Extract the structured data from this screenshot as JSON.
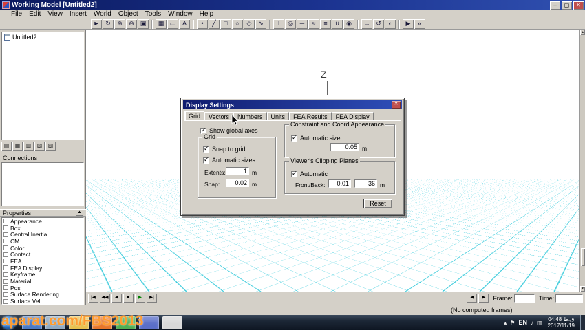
{
  "titlebar": {
    "title": "Working Model [Untitled2]",
    "buttons": [
      {
        "name": "minimize-button",
        "glyph": "–"
      },
      {
        "name": "maximize-button",
        "glyph": "▢"
      },
      {
        "name": "close-button",
        "glyph": "✕",
        "bg": "#c0504d",
        "color": "#ffffff"
      }
    ]
  },
  "menubar": {
    "items": [
      "File",
      "Edit",
      "View",
      "Insert",
      "World",
      "Object",
      "Tools",
      "Window",
      "Help"
    ]
  },
  "toolbar": {
    "icons": [
      {
        "name": "select-tool-icon",
        "glyph": "►"
      },
      {
        "name": "rotate-tool-icon",
        "glyph": "↻"
      },
      {
        "name": "zoom-in-icon",
        "glyph": "⊕"
      },
      {
        "name": "zoom-out-icon",
        "glyph": "⊖"
      },
      {
        "name": "zoom-extents-icon",
        "glyph": "▣"
      },
      {
        "sep": true
      },
      {
        "name": "grid-snap-icon",
        "glyph": "▦"
      },
      {
        "name": "ruler-icon",
        "glyph": "▭"
      },
      {
        "name": "text-tool-icon",
        "glyph": "A"
      },
      {
        "sep": true
      },
      {
        "name": "point-tool-icon",
        "glyph": "•"
      },
      {
        "name": "line-tool-icon",
        "glyph": "╱"
      },
      {
        "name": "rectangle-tool-icon",
        "glyph": "□"
      },
      {
        "name": "circle-tool-icon",
        "glyph": "○"
      },
      {
        "name": "polygon-tool-icon",
        "glyph": "◇"
      },
      {
        "name": "curve-tool-icon",
        "glyph": "∿"
      },
      {
        "sep": true
      },
      {
        "name": "anchor-tool-icon",
        "glyph": "⊥"
      },
      {
        "name": "pin-joint-icon",
        "glyph": "◎"
      },
      {
        "name": "rod-tool-icon",
        "glyph": "─"
      },
      {
        "name": "spring-tool-icon",
        "glyph": "≈"
      },
      {
        "name": "damper-tool-icon",
        "glyph": "≡"
      },
      {
        "name": "rope-tool-icon",
        "glyph": "∪"
      },
      {
        "name": "pulley-tool-icon",
        "glyph": "◉"
      },
      {
        "sep": true
      },
      {
        "name": "force-tool-icon",
        "glyph": "→"
      },
      {
        "name": "torque-tool-icon",
        "glyph": "↺"
      },
      {
        "name": "motor-tool-icon",
        "glyph": "◐"
      },
      {
        "sep": true
      },
      {
        "name": "run-tool-icon",
        "glyph": "▶"
      },
      {
        "name": "reset-tool-icon",
        "glyph": "«"
      }
    ]
  },
  "sidebar": {
    "tree_root": "Untitled2",
    "mini_tabs": [
      {
        "name": "browser-outline-tab",
        "glyph": "▤"
      },
      {
        "name": "browser-grid-tab",
        "glyph": "▦"
      },
      {
        "name": "browser-split-tab",
        "glyph": "▥"
      },
      {
        "name": "browser-diagonal-tab",
        "glyph": "▧"
      },
      {
        "name": "browser-shade-tab",
        "glyph": "▨"
      }
    ],
    "connections_label": "Connections",
    "properties_label": "Properties",
    "collapse_glyph": "▲",
    "properties": [
      "Appearance",
      "Box",
      "Central Inertia",
      "CM",
      "Color",
      "Contact",
      "FEA",
      "FEA Display",
      "Keyframe",
      "Material",
      "Pos",
      "Surface Rendering",
      "Surface Vel"
    ]
  },
  "canvas": {
    "axis_label": "Z",
    "grid_color": "#2cc7d9",
    "scroll_up_glyph": "▲",
    "scroll_down_glyph": "▼"
  },
  "dialog": {
    "title": "Display Settings",
    "close_glyph": "✕",
    "tabs": [
      {
        "name": "tab-grid",
        "label": "Grid",
        "selected": true
      },
      {
        "name": "tab-vectors",
        "label": "Vectors"
      },
      {
        "name": "tab-numbers",
        "label": "Numbers"
      },
      {
        "name": "tab-units",
        "label": "Units"
      },
      {
        "name": "tab-fea-results",
        "label": "FEA Results"
      },
      {
        "name": "tab-fea-display",
        "label": "FEA Display"
      }
    ],
    "show_global_axes": {
      "label": "Show global axes",
      "checked": true
    },
    "grid_group": {
      "title": "Grid",
      "snap_to_grid": {
        "label": "Snap to grid",
        "checked": true
      },
      "automatic_sizes": {
        "label": "Automatic sizes",
        "checked": true
      },
      "extents_label": "Extents:",
      "extents_value": "1",
      "extents_unit": "m",
      "snap_label": "Snap:",
      "snap_value": "0.02",
      "snap_unit": "m"
    },
    "constraint_group": {
      "title": "Constraint and Coord Appearance",
      "automatic_size": {
        "label": "Automatic size",
        "checked": true
      },
      "size_value": "0.05",
      "size_unit": "m"
    },
    "clipping_group": {
      "title": "Viewer's Clipping Planes",
      "automatic": {
        "label": "Automatic",
        "checked": true
      },
      "front_back_label": "Front/Back:",
      "front_value": "0.01",
      "back_value": "36",
      "unit": "m"
    },
    "reset_label": "Reset"
  },
  "playback": {
    "left_buttons": [
      {
        "name": "reset-to-start-button",
        "glyph": "|◀"
      },
      {
        "name": "rewind-button",
        "glyph": "◀◀"
      },
      {
        "name": "step-back-button",
        "glyph": "◀"
      },
      {
        "name": "stop-button",
        "glyph": "■"
      },
      {
        "name": "run-button",
        "glyph": "▶",
        "color": "#008000"
      },
      {
        "name": "step-forward-button",
        "glyph": "▶|"
      }
    ],
    "right_buttons": [
      {
        "name": "frame-back-button",
        "glyph": "◀"
      },
      {
        "name": "frame-forward-button",
        "glyph": "▶"
      }
    ],
    "frame_label": "Frame:",
    "frame_value": "",
    "time_label": "Time:",
    "time_value": ""
  },
  "statusbar": {
    "message": "(No computed frames)"
  },
  "taskbar": {
    "apps": [
      {
        "name": "taskbar-app-icon-1",
        "bg": "#4a79c4"
      },
      {
        "name": "taskbar-app-icon-2",
        "bg": "#8fa8bf"
      },
      {
        "name": "taskbar-folder-icon",
        "bg": "#e7c14e"
      },
      {
        "name": "taskbar-firefox-icon",
        "bg": "#e8762a"
      },
      {
        "name": "taskbar-app-icon-5",
        "bg": "#4fae52"
      },
      {
        "name": "taskbar-app-icon-6",
        "bg": "#5a6ec8"
      },
      {
        "name": "taskbar-app-icon-7",
        "bg": "#d8d8d8"
      }
    ],
    "tray": {
      "expand_glyph": "▴",
      "flag_glyph": "⚑",
      "language": "EN",
      "speaker_glyph": "♪",
      "network_glyph": "▥",
      "time": "04:48 ق.ظ",
      "date": "2017/11/19"
    }
  },
  "watermark": {
    "text": "aparat.com/FBS2013"
  }
}
